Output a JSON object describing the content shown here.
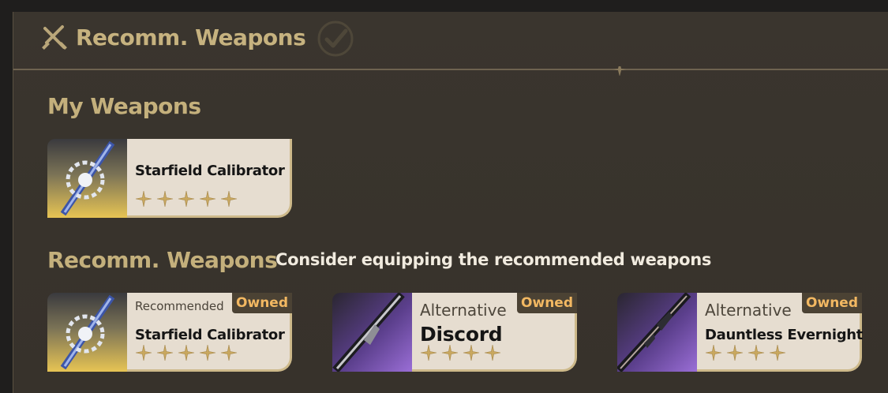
{
  "header": {
    "title": "Recomm. Weapons",
    "icon": "crossed-swords-icon",
    "check_icon": "checkmark-circle-icon"
  },
  "my_weapons": {
    "title": "My Weapons",
    "items": [
      {
        "name": "Starfield Calibrator",
        "stars": 5
      }
    ]
  },
  "recommended": {
    "title": "Recomm. Weapons",
    "subtitle": "Consider equipping the recommended weapons",
    "items": [
      {
        "tag": "Recommended",
        "owned": "Owned",
        "name": "Starfield Calibrator",
        "stars": 5
      },
      {
        "tag": "Alternative",
        "owned": "Owned",
        "name": "Discord",
        "stars": 4
      },
      {
        "tag": "Alternative",
        "owned": "Owned",
        "name": "Dauntless Evernight",
        "stars": 4
      }
    ]
  },
  "colors": {
    "accent_gold": "#c6b27f",
    "owned_text": "#f2b862",
    "card_bg": "#e6ddd0",
    "five_star_bg": "#d9b84a",
    "four_star_bg": "#7a55b0"
  }
}
